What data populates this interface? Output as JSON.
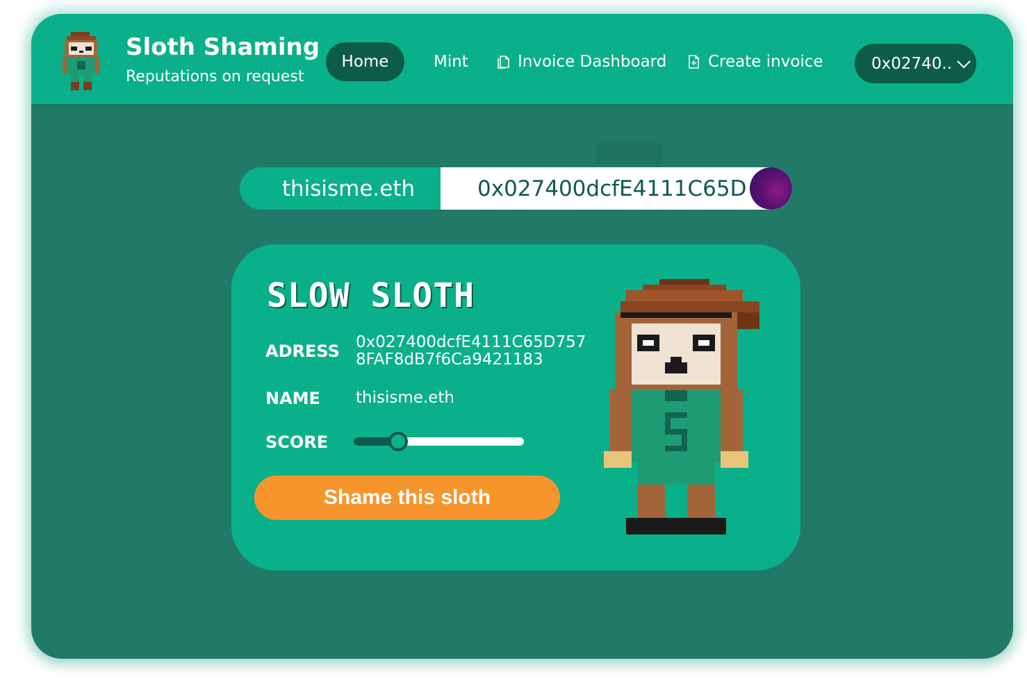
{
  "header": {
    "brand_title": "Sloth Shaming",
    "brand_subtitle": "Reputations on request",
    "nav": {
      "home": "Home",
      "mint": "Mint",
      "invoice_dashboard": "Invoice Dashboard",
      "create_invoice": "Create invoice"
    },
    "wallet_label": "0x02740..",
    "icons": [
      "sloth-logo",
      "documents-icon",
      "new-document-icon",
      "chevron-down-icon"
    ]
  },
  "ens_lookup": {
    "name": "thisisme.eth",
    "address": "0x027400dcfE4111C65D"
  },
  "profile_card": {
    "title": "SLOW SLOTH",
    "address_label": "ADRESS",
    "address_value": "0x027400dcfE4111C65D7578FAF8dB7f6Ca9421183",
    "name_label": "NAME",
    "name_value": "thisisme.eth",
    "score_label": "SCORE",
    "score_fraction": 0.26,
    "shame_button": "Shame this sloth"
  },
  "colors": {
    "header_green": "#0ab089",
    "background_green": "#217a67",
    "dark_green": "#0d5c47",
    "button_orange": "#f7952d"
  }
}
